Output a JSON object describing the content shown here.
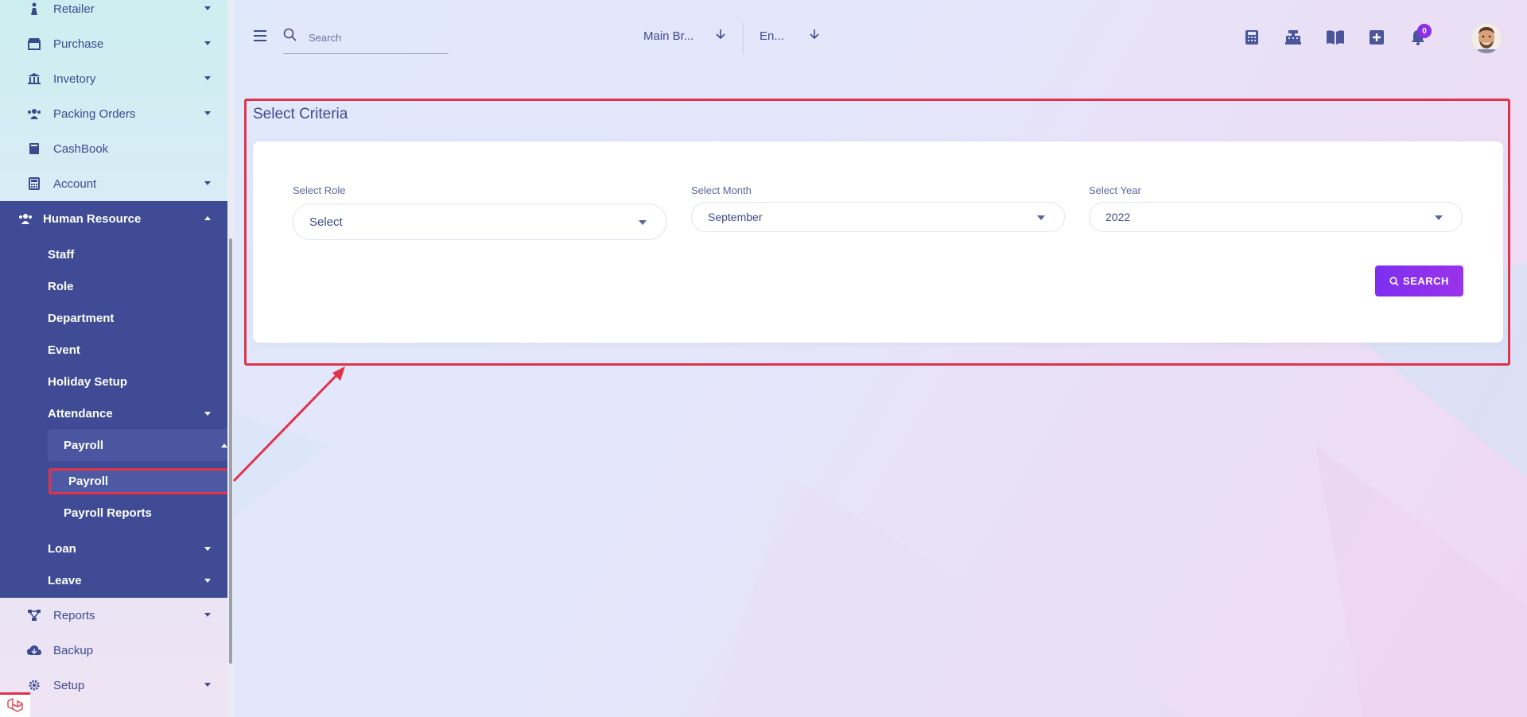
{
  "sidebar": {
    "top_items": [
      {
        "label": "Retailer",
        "icon": "person-icon"
      },
      {
        "label": "Purchase",
        "icon": "store-icon"
      },
      {
        "label": "Invetory",
        "icon": "bank-icon"
      },
      {
        "label": "Packing Orders",
        "icon": "users-icon"
      },
      {
        "label": "CashBook",
        "icon": "book-icon"
      },
      {
        "label": "Account",
        "icon": "calculator-icon"
      }
    ],
    "human_resource": {
      "label": "Human Resource",
      "items": [
        {
          "label": "Staff"
        },
        {
          "label": "Role"
        },
        {
          "label": "Department"
        },
        {
          "label": "Event"
        },
        {
          "label": "Holiday Setup"
        },
        {
          "label": "Attendance"
        }
      ],
      "payroll_group": {
        "label": "Payroll",
        "items": [
          {
            "label": "Payroll"
          },
          {
            "label": "Payroll Reports"
          }
        ]
      },
      "after_items": [
        {
          "label": "Loan"
        },
        {
          "label": "Leave"
        }
      ]
    },
    "bottom_items": [
      {
        "label": "Reports",
        "icon": "network-icon"
      },
      {
        "label": "Backup",
        "icon": "cloud-icon"
      },
      {
        "label": "Setup",
        "icon": "gear-icon"
      }
    ]
  },
  "topbar": {
    "search_placeholder": "Search",
    "branch": "Main Br...",
    "language": "En...",
    "notification_count": "0",
    "icons": [
      "calculator-icon",
      "cash-register-icon",
      "book-open-icon",
      "plus-square-icon",
      "bell-icon"
    ]
  },
  "main": {
    "title": "Select Criteria",
    "role": {
      "label": "Select Role",
      "value": "Select"
    },
    "month": {
      "label": "Select Month",
      "value": "September"
    },
    "year": {
      "label": "Select Year",
      "value": "2022"
    },
    "search_button": "SEARCH"
  },
  "colors": {
    "sidebar_active": "#3f4b95",
    "accent": "#8b2fe8",
    "highlight": "#e0334a"
  }
}
